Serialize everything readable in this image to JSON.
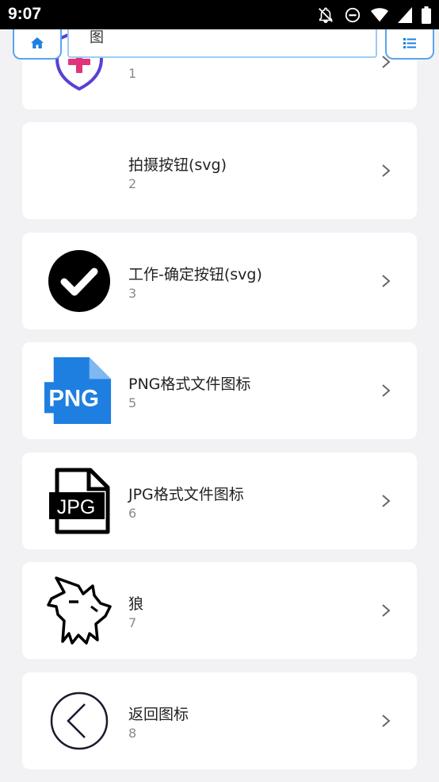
{
  "status_bar": {
    "time": "9:07",
    "icons": [
      "notifications-off-icon",
      "do-not-disturb-icon",
      "wifi-icon",
      "signal-icon",
      "battery-icon"
    ]
  },
  "search": {
    "value": "图"
  },
  "items": [
    {
      "title": "",
      "number": "1",
      "icon": "shield-plus-icon"
    },
    {
      "title": "拍摄按钮(svg)",
      "number": "2",
      "icon": "blank-icon"
    },
    {
      "title": "工作-确定按钮(svg)",
      "number": "3",
      "icon": "check-circle-icon"
    },
    {
      "title": "PNG格式文件图标",
      "number": "5",
      "icon": "png-file-icon",
      "icon_text": "PNG"
    },
    {
      "title": "JPG格式文件图标",
      "number": "6",
      "icon": "jpg-file-icon",
      "icon_text": "JPG"
    },
    {
      "title": "狼",
      "number": "7",
      "icon": "wolf-icon"
    },
    {
      "title": "返回图标",
      "number": "8",
      "icon": "back-circle-icon"
    }
  ],
  "colors": {
    "accent": "#5aa4ef",
    "background": "#f2f2f5",
    "png_blue": "#1f7fe0",
    "shield_purple": "#5b3fd6",
    "shield_pink": "#e0337a"
  }
}
